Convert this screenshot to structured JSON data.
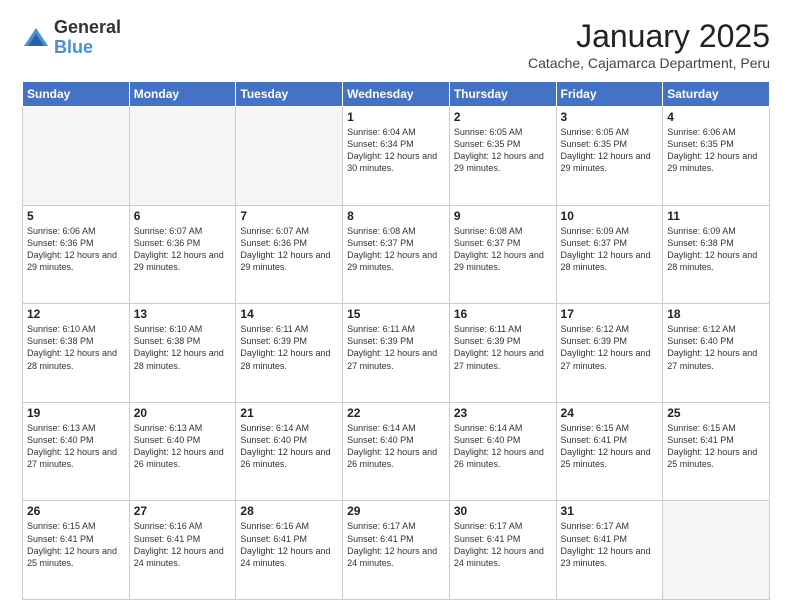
{
  "logo": {
    "general": "General",
    "blue": "Blue"
  },
  "header": {
    "month": "January 2025",
    "location": "Catache, Cajamarca Department, Peru"
  },
  "weekdays": [
    "Sunday",
    "Monday",
    "Tuesday",
    "Wednesday",
    "Thursday",
    "Friday",
    "Saturday"
  ],
  "weeks": [
    [
      {
        "day": "",
        "info": ""
      },
      {
        "day": "",
        "info": ""
      },
      {
        "day": "",
        "info": ""
      },
      {
        "day": "1",
        "info": "Sunrise: 6:04 AM\nSunset: 6:34 PM\nDaylight: 12 hours and 30 minutes."
      },
      {
        "day": "2",
        "info": "Sunrise: 6:05 AM\nSunset: 6:35 PM\nDaylight: 12 hours and 29 minutes."
      },
      {
        "day": "3",
        "info": "Sunrise: 6:05 AM\nSunset: 6:35 PM\nDaylight: 12 hours and 29 minutes."
      },
      {
        "day": "4",
        "info": "Sunrise: 6:06 AM\nSunset: 6:35 PM\nDaylight: 12 hours and 29 minutes."
      }
    ],
    [
      {
        "day": "5",
        "info": "Sunrise: 6:06 AM\nSunset: 6:36 PM\nDaylight: 12 hours and 29 minutes."
      },
      {
        "day": "6",
        "info": "Sunrise: 6:07 AM\nSunset: 6:36 PM\nDaylight: 12 hours and 29 minutes."
      },
      {
        "day": "7",
        "info": "Sunrise: 6:07 AM\nSunset: 6:36 PM\nDaylight: 12 hours and 29 minutes."
      },
      {
        "day": "8",
        "info": "Sunrise: 6:08 AM\nSunset: 6:37 PM\nDaylight: 12 hours and 29 minutes."
      },
      {
        "day": "9",
        "info": "Sunrise: 6:08 AM\nSunset: 6:37 PM\nDaylight: 12 hours and 29 minutes."
      },
      {
        "day": "10",
        "info": "Sunrise: 6:09 AM\nSunset: 6:37 PM\nDaylight: 12 hours and 28 minutes."
      },
      {
        "day": "11",
        "info": "Sunrise: 6:09 AM\nSunset: 6:38 PM\nDaylight: 12 hours and 28 minutes."
      }
    ],
    [
      {
        "day": "12",
        "info": "Sunrise: 6:10 AM\nSunset: 6:38 PM\nDaylight: 12 hours and 28 minutes."
      },
      {
        "day": "13",
        "info": "Sunrise: 6:10 AM\nSunset: 6:38 PM\nDaylight: 12 hours and 28 minutes."
      },
      {
        "day": "14",
        "info": "Sunrise: 6:11 AM\nSunset: 6:39 PM\nDaylight: 12 hours and 28 minutes."
      },
      {
        "day": "15",
        "info": "Sunrise: 6:11 AM\nSunset: 6:39 PM\nDaylight: 12 hours and 27 minutes."
      },
      {
        "day": "16",
        "info": "Sunrise: 6:11 AM\nSunset: 6:39 PM\nDaylight: 12 hours and 27 minutes."
      },
      {
        "day": "17",
        "info": "Sunrise: 6:12 AM\nSunset: 6:39 PM\nDaylight: 12 hours and 27 minutes."
      },
      {
        "day": "18",
        "info": "Sunrise: 6:12 AM\nSunset: 6:40 PM\nDaylight: 12 hours and 27 minutes."
      }
    ],
    [
      {
        "day": "19",
        "info": "Sunrise: 6:13 AM\nSunset: 6:40 PM\nDaylight: 12 hours and 27 minutes."
      },
      {
        "day": "20",
        "info": "Sunrise: 6:13 AM\nSunset: 6:40 PM\nDaylight: 12 hours and 26 minutes."
      },
      {
        "day": "21",
        "info": "Sunrise: 6:14 AM\nSunset: 6:40 PM\nDaylight: 12 hours and 26 minutes."
      },
      {
        "day": "22",
        "info": "Sunrise: 6:14 AM\nSunset: 6:40 PM\nDaylight: 12 hours and 26 minutes."
      },
      {
        "day": "23",
        "info": "Sunrise: 6:14 AM\nSunset: 6:40 PM\nDaylight: 12 hours and 26 minutes."
      },
      {
        "day": "24",
        "info": "Sunrise: 6:15 AM\nSunset: 6:41 PM\nDaylight: 12 hours and 25 minutes."
      },
      {
        "day": "25",
        "info": "Sunrise: 6:15 AM\nSunset: 6:41 PM\nDaylight: 12 hours and 25 minutes."
      }
    ],
    [
      {
        "day": "26",
        "info": "Sunrise: 6:15 AM\nSunset: 6:41 PM\nDaylight: 12 hours and 25 minutes."
      },
      {
        "day": "27",
        "info": "Sunrise: 6:16 AM\nSunset: 6:41 PM\nDaylight: 12 hours and 24 minutes."
      },
      {
        "day": "28",
        "info": "Sunrise: 6:16 AM\nSunset: 6:41 PM\nDaylight: 12 hours and 24 minutes."
      },
      {
        "day": "29",
        "info": "Sunrise: 6:17 AM\nSunset: 6:41 PM\nDaylight: 12 hours and 24 minutes."
      },
      {
        "day": "30",
        "info": "Sunrise: 6:17 AM\nSunset: 6:41 PM\nDaylight: 12 hours and 24 minutes."
      },
      {
        "day": "31",
        "info": "Sunrise: 6:17 AM\nSunset: 6:41 PM\nDaylight: 12 hours and 23 minutes."
      },
      {
        "day": "",
        "info": ""
      }
    ]
  ]
}
